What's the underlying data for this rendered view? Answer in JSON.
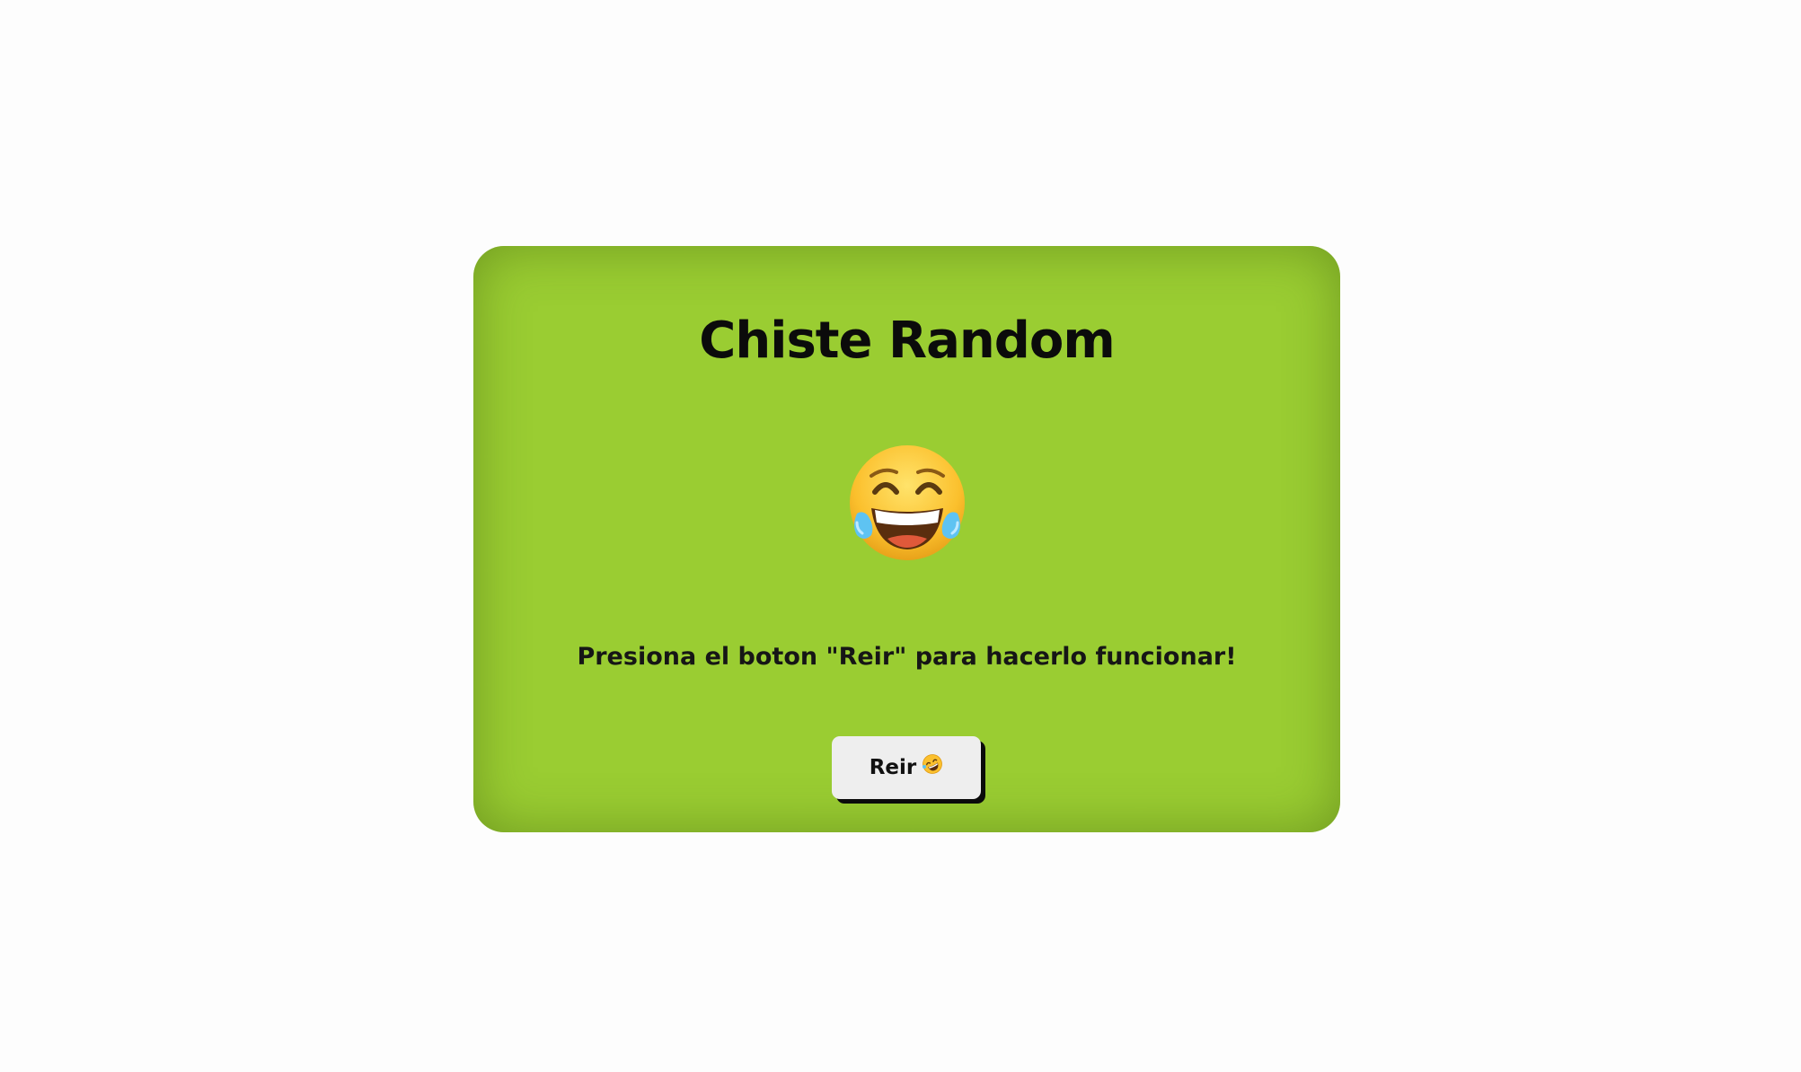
{
  "colors": {
    "page_background": "#fdfdfd",
    "card_background": "#9acd32",
    "button_background": "#eeeeee",
    "button_shadow": "#0b0b0b",
    "text": "#0b0b0b"
  },
  "card": {
    "title": "Chiste Random",
    "emoji_icon": "face-with-tears-of-joy-icon",
    "message": "Presiona el boton \"Reir\" para hacerlo funcionar!"
  },
  "button": {
    "label": "Reir",
    "icon": "rolling-on-the-floor-laughing-icon"
  }
}
